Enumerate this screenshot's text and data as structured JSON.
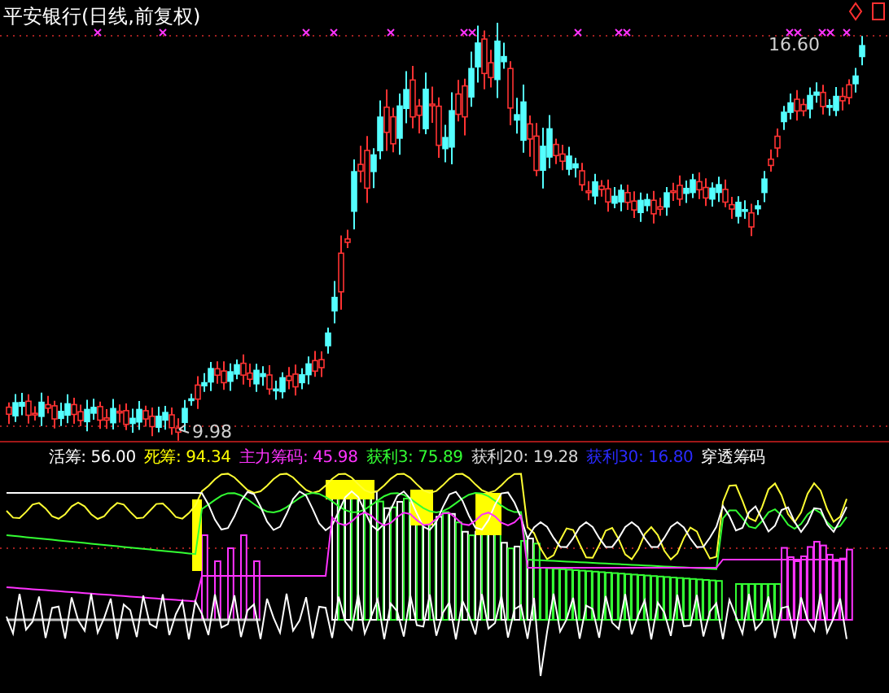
{
  "title": "平安银行(日线,前复权)",
  "price_labels": {
    "high": "16.60",
    "low": "9.98"
  },
  "indicator_legend": [
    {
      "text": "活筹: 56.00",
      "color": "#ffffff"
    },
    {
      "text": "死筹: 94.34",
      "color": "#ffff00"
    },
    {
      "text": "主力筹码: 45.98",
      "color": "#ff33ff"
    },
    {
      "text": "获利3: 75.89",
      "color": "#33ff33"
    },
    {
      "text": "获利20: 19.28",
      "color": "#d8d8d8"
    },
    {
      "text": "获利30: 16.80",
      "color": "#2a2aff"
    },
    {
      "text": "穿透筹码",
      "color": "#ffffff"
    }
  ]
}
